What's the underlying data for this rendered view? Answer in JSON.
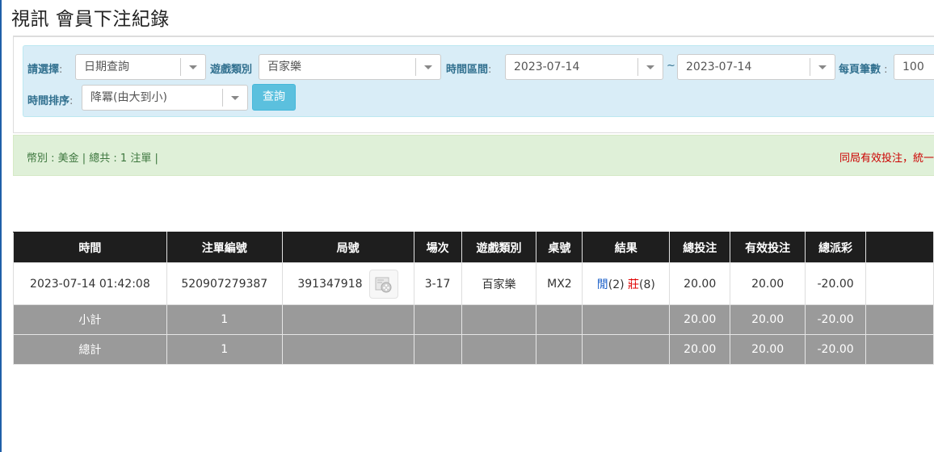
{
  "page": {
    "title": "視訊 會員下注紀錄"
  },
  "filters": {
    "select_label": "請選擇",
    "select_value": "日期查詢",
    "game_type_label": "遊戲類別",
    "game_type_value": "百家樂",
    "time_range_label": "時間區間",
    "date_from": "2023-07-14",
    "tilde": "~",
    "date_to": "2023-07-14",
    "per_page_label": "每頁筆數",
    "per_page_value": "100",
    "sort_label": "時間排序",
    "sort_value": "降冪(由大到小)",
    "query_button": "查詢"
  },
  "info": {
    "summary": "幣別 : 美金 | 總共 : 1 注單 |",
    "notice": "同局有效投注，統一"
  },
  "table": {
    "headers": [
      "時間",
      "注單編號",
      "局號",
      "場次",
      "遊戲類別",
      "桌號",
      "結果",
      "總投注",
      "有效投注",
      "總派彩",
      ""
    ],
    "row": {
      "time": "2023-07-14 01:42:08",
      "bet_id": "520907279387",
      "round_id": "391347918",
      "session": "3-17",
      "game_type": "百家樂",
      "table_no": "MX2",
      "result_player": "閒",
      "result_player_count": "(2)",
      "result_banker": "莊",
      "result_banker_count": "(8)",
      "total_bet": "20.00",
      "valid_bet": "20.00",
      "payout": "-20.00"
    },
    "subtotal": {
      "label": "小計",
      "count": "1",
      "total_bet": "20.00",
      "valid_bet": "20.00",
      "payout": "-20.00"
    },
    "grand_total": {
      "label": "總計",
      "count": "1",
      "total_bet": "20.00",
      "valid_bet": "20.00",
      "payout": "-20.00"
    }
  },
  "icons": {
    "replay": "video-replay-icon"
  },
  "colors": {
    "header_bg": "#1e1e1e",
    "filter_bg": "#d9edf7",
    "info_bg": "#dff0d8",
    "negative": "#e00000",
    "blue": "#1a5fc8"
  }
}
